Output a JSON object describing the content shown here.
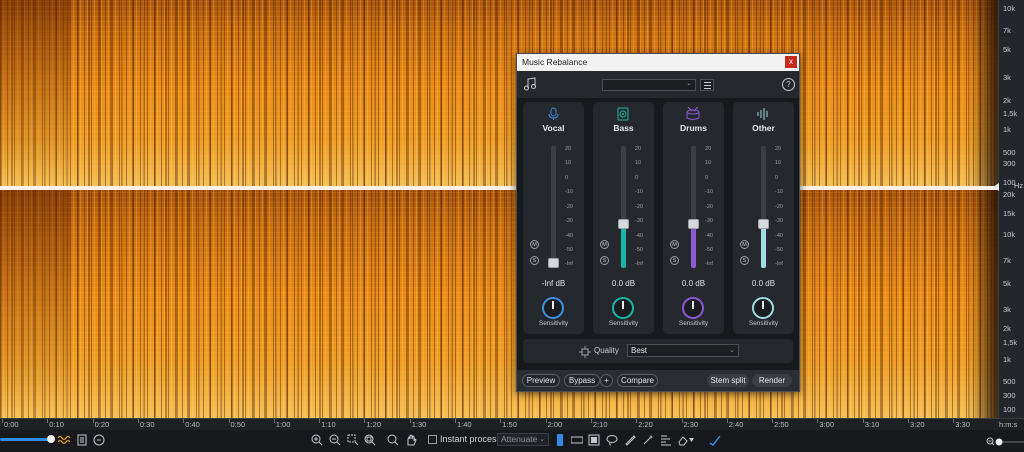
{
  "frequency_axis": {
    "labels": [
      "10k",
      "7k",
      "5k",
      "3k",
      "2k",
      "1,5k",
      "1k",
      "500",
      "300",
      "100",
      "20k",
      "15k",
      "10k",
      "7k",
      "5k",
      "3k",
      "2k",
      "1,5k",
      "1k",
      "500",
      "300",
      "100"
    ],
    "unit": "Hz"
  },
  "time_axis": {
    "labels": [
      "0:00",
      "0:10",
      "0:20",
      "0:30",
      "0:40",
      "0:50",
      "1:00",
      "1:10",
      "1:20",
      "1:30",
      "1:40",
      "1:50",
      "2:00",
      "2:10",
      "2:20",
      "2:30",
      "2:40",
      "2:50",
      "3:00",
      "3:10",
      "3:20",
      "3:30"
    ],
    "unit": "h:m:s"
  },
  "toolbar": {
    "instant_process_label": "Instant process",
    "attenuate_value": "Attenuate",
    "opacity_level": 0.85,
    "accent": "#2f8df0"
  },
  "dialog": {
    "title": "Music Rebalance",
    "close_label": "x",
    "preset_value": "",
    "help_label": "?",
    "stems": [
      {
        "name": "Vocal",
        "icon": "microphone-icon",
        "color": "#3d8fe3",
        "db": "-Inf dB",
        "gain_db": null,
        "sensitivity_label": "Sensitivity",
        "mute": "M",
        "solo": "S"
      },
      {
        "name": "Bass",
        "icon": "speaker-icon",
        "color": "#19b5a8",
        "db": "0.0 dB",
        "gain_db": 0.0,
        "sensitivity_label": "Sensitivity",
        "mute": "M",
        "solo": "S"
      },
      {
        "name": "Drums",
        "icon": "drum-icon",
        "color": "#8d5ad6",
        "db": "0.0 dB",
        "gain_db": 0.0,
        "sensitivity_label": "Sensitivity",
        "mute": "M",
        "solo": "S"
      },
      {
        "name": "Other",
        "icon": "waveform-icon",
        "color": "#9fdde0",
        "db": "0.0 dB",
        "gain_db": 0.0,
        "sensitivity_label": "Sensitivity",
        "mute": "M",
        "solo": "S"
      }
    ],
    "fader_scale": [
      "20",
      "10",
      "0",
      "-10",
      "-20",
      "-30",
      "-40",
      "-50",
      "-Inf"
    ],
    "quality_label": "Quality",
    "quality_value": "Best",
    "buttons": {
      "preview": "Preview",
      "bypass": "Bypass",
      "plus": "+",
      "compare": "Compare",
      "stem_split": "Stem split",
      "render": "Render"
    }
  }
}
